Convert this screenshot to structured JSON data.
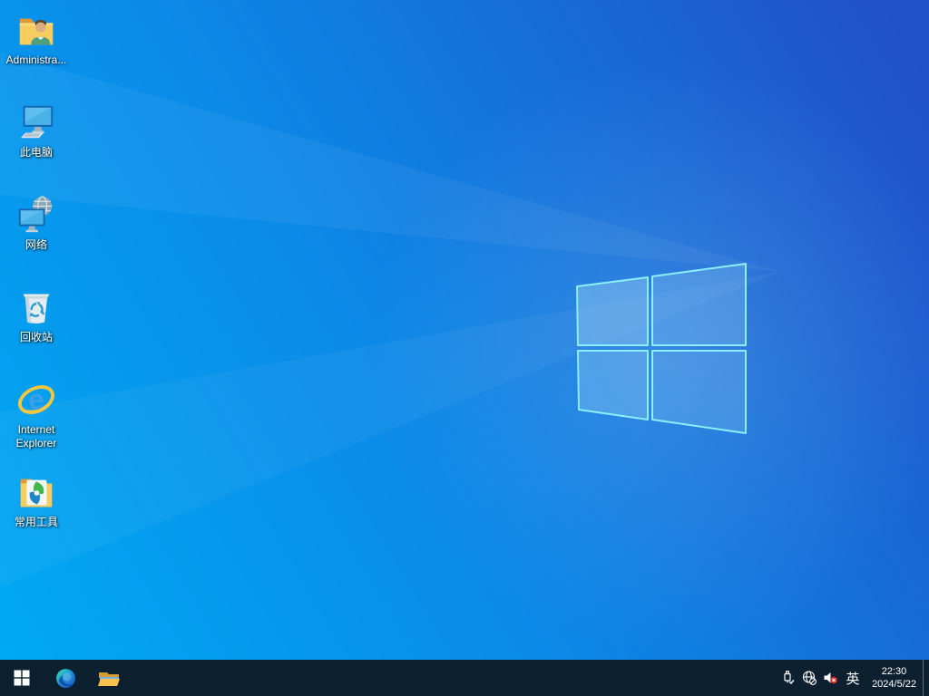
{
  "desktop": {
    "icons": [
      {
        "label": "Administra...",
        "icon": "user-folder-icon"
      },
      {
        "label": "此电脑",
        "icon": "this-pc-icon"
      },
      {
        "label": "网络",
        "icon": "network-icon"
      },
      {
        "label": "回收站",
        "icon": "recycle-bin-icon"
      },
      {
        "label": "Internet Explorer",
        "icon": "internet-explorer-icon"
      },
      {
        "label": "常用工具",
        "icon": "tools-folder-icon"
      }
    ]
  },
  "taskbar": {
    "buttons": [
      {
        "icon": "windows-start-icon"
      },
      {
        "icon": "edge-browser-icon"
      },
      {
        "icon": "file-explorer-icon"
      }
    ],
    "tray": {
      "icons": [
        "usb-safely-remove-icon",
        "network-no-internet-icon",
        "volume-muted-icon"
      ],
      "ime_indicator": "英"
    },
    "clock": {
      "time": "22:30",
      "date": "2024/5/22"
    }
  },
  "colors": {
    "wallpaper_left": "#00a9f3",
    "wallpaper_right": "#2151c8",
    "logo_edge": "#8aeefb",
    "taskbar": "#0c2030",
    "mute_badge": "#d93025",
    "label_text": "#ffffff"
  }
}
